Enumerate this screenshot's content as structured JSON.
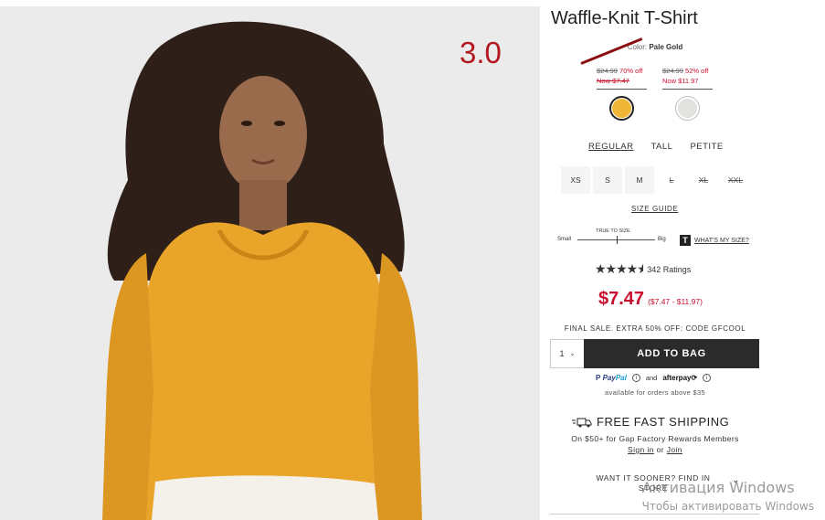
{
  "photo": {
    "overlay_label": "3.0",
    "label_color": "#b3171f",
    "shirt_color": "#e9a52a",
    "background": "#ebebeb"
  },
  "product": {
    "title": "Waffle-Knit T-Shirt",
    "color_label": "Color:",
    "color_value": "Pale Gold",
    "swatches": [
      {
        "old_price": "$24.99",
        "discount": "70% off",
        "now": "Now $7.47",
        "color": "#f0b637",
        "selected": true
      },
      {
        "old_price": "$24.99",
        "discount": "52% off",
        "now": "Now $11.97",
        "color": "#e2e2de",
        "selected": false
      }
    ],
    "fits": [
      "REGULAR",
      "TALL",
      "PETITE"
    ],
    "sizes": [
      {
        "label": "XS",
        "available": true
      },
      {
        "label": "S",
        "available": true
      },
      {
        "label": "M",
        "available": true
      },
      {
        "label": "L",
        "available": false
      },
      {
        "label": "XL",
        "available": false
      },
      {
        "label": "XXL",
        "available": false
      }
    ],
    "size_guide": "SIZE GUIDE",
    "fit_meter": {
      "small": "Small",
      "big": "Big",
      "center": "TRUE TO SIZE"
    },
    "whats_my_size": "WHAT'S MY SIZE?",
    "whats_icon_letter": "T",
    "rating": {
      "stars": 4.5,
      "text": "342 Ratings"
    },
    "price": "$7.47",
    "price_range": "($7.47 - $11.97)",
    "promo": "FINAL SALE. EXTRA 50% OFF: CODE GFCOOL",
    "quantity": "1",
    "add_to_bag": "ADD TO BAG",
    "payment": {
      "paypal_a": "Pay",
      "paypal_b": "Pal",
      "and": "and",
      "afterpay": "afterpay",
      "available": "available for orders above $35"
    },
    "shipping": {
      "headline": "FREE FAST SHIPPING",
      "subline": "On $50+ for Gap Factory Rewards Members",
      "sign_in": "Sign in",
      "or": "or",
      "join": "Join"
    },
    "store": {
      "label": "WANT IT SOONER? FIND IN STORE"
    }
  },
  "os_watermark": {
    "line1": "Активация Windows",
    "line2": "Чтобы активировать Windows"
  }
}
